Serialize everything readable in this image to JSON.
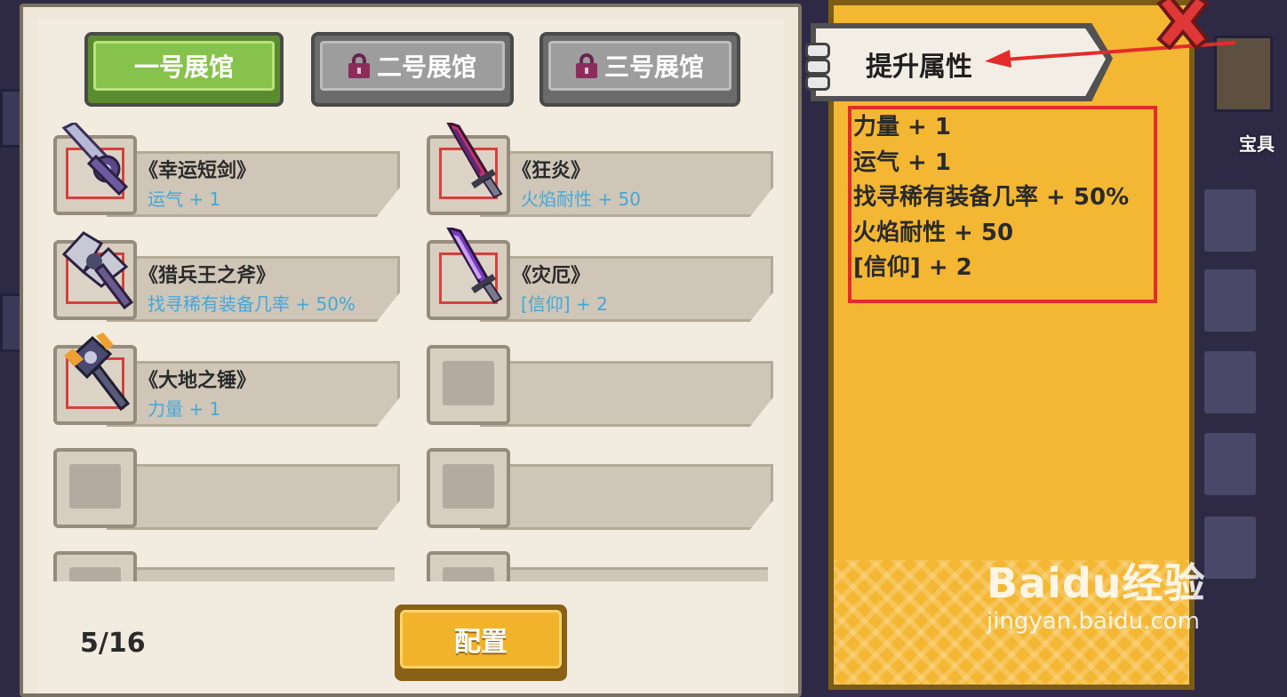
{
  "halls": [
    {
      "label": "一号展馆",
      "locked": false,
      "selected": true
    },
    {
      "label": "二号展馆",
      "locked": true,
      "selected": false
    },
    {
      "label": "三号展馆",
      "locked": true,
      "selected": false
    }
  ],
  "slots": [
    {
      "name": "《幸运短剑》",
      "attr": "运气 + 1",
      "icon": "lucky-dagger-icon"
    },
    {
      "name": "《狂炎》",
      "attr": "火焰耐性 + 50",
      "icon": "frenzy-flame-sword-icon"
    },
    {
      "name": "《猎兵王之斧》",
      "attr": "找寻稀有装备几率 + 50%",
      "icon": "hunter-king-axe-icon"
    },
    {
      "name": "《灾厄》",
      "attr": "[信仰] + 2",
      "icon": "calamity-sword-icon"
    },
    {
      "name": "《大地之锤》",
      "attr": "力量 + 1",
      "icon": "earth-hammer-icon"
    },
    {
      "name": "",
      "attr": "",
      "icon": ""
    },
    {
      "name": "",
      "attr": "",
      "icon": ""
    },
    {
      "name": "",
      "attr": "",
      "icon": ""
    },
    {
      "name": "",
      "attr": "",
      "icon": ""
    },
    {
      "name": "",
      "attr": "",
      "icon": ""
    }
  ],
  "count": "5/16",
  "config_label": "配置",
  "side": {
    "title": "提升属性",
    "attributes": [
      "力量 + 1",
      "运气 + 1",
      "找寻稀有装备几率 + 50%",
      "火焰耐性 + 50",
      "[信仰] + 2"
    ]
  },
  "treasure_label": "宝具",
  "watermark": {
    "brand": "Baidu经验",
    "url": "jingyan.baidu.com"
  },
  "colors": {
    "accent_green": "#86c24c",
    "panel_yellow": "#f4b733",
    "attr_blue": "#45a7d8",
    "highlight_red": "#e32b2b"
  }
}
